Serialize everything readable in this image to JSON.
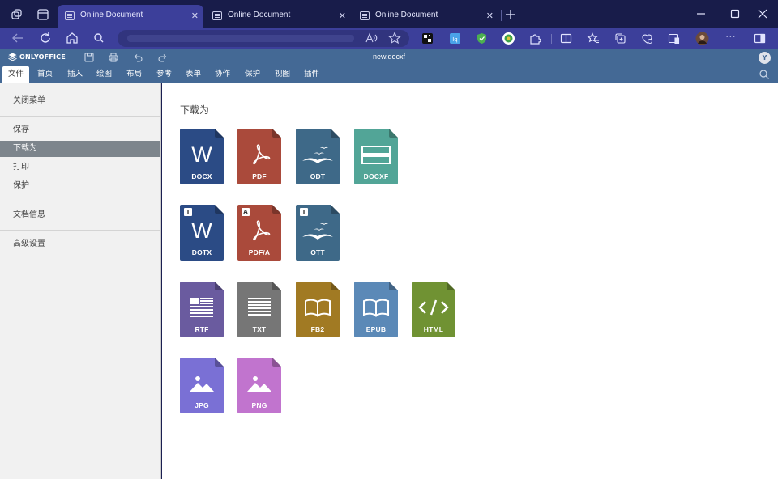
{
  "browser": {
    "tabs": [
      {
        "title": "Online Document",
        "active": true
      },
      {
        "title": "Online Document",
        "active": false
      },
      {
        "title": "Online Document",
        "active": false
      }
    ],
    "colors": {
      "titlebar": "#181c4a",
      "toolbar": "#3c3f9a"
    }
  },
  "app": {
    "logo_text": "ONLYOFFICE",
    "document_name": "new.docxf",
    "user_initial": "Y",
    "menu_tabs": [
      "文件",
      "首页",
      "插入",
      "绘图",
      "布局",
      "参考",
      "表单",
      "协作",
      "保护",
      "视图",
      "插件"
    ],
    "active_tab": "文件",
    "header_color": "#446995"
  },
  "sidebar": {
    "close_menu": "关闭菜单",
    "items": [
      "保存",
      "下载为",
      "打印",
      "保护"
    ],
    "active_item": "下载为",
    "doc_info": "文档信息",
    "advanced": "高级设置"
  },
  "download": {
    "title": "下载为",
    "formats": [
      {
        "label": "DOCX",
        "color": "#2b4b85",
        "icon": "word-icon",
        "badge": ""
      },
      {
        "label": "PDF",
        "color": "#aa4a3b",
        "icon": "pdf-icon",
        "badge": ""
      },
      {
        "label": "ODT",
        "color": "#3e6988",
        "icon": "odt-gulls-icon",
        "badge": ""
      },
      {
        "label": "DOCXF",
        "color": "#52a597",
        "icon": "form-fields-icon",
        "badge": ""
      },
      {
        "label": "DOTX",
        "color": "#2b4b85",
        "icon": "word-icon",
        "badge": "T"
      },
      {
        "label": "PDF/A",
        "color": "#aa4a3b",
        "icon": "pdf-icon",
        "badge": "A"
      },
      {
        "label": "OTT",
        "color": "#3e6988",
        "icon": "odt-gulls-icon",
        "badge": "T"
      },
      {
        "label": "RTF",
        "color": "#6a5b9f",
        "icon": "rich-text-icon",
        "badge": ""
      },
      {
        "label": "TXT",
        "color": "#767676",
        "icon": "plain-text-icon",
        "badge": ""
      },
      {
        "label": "FB2",
        "color": "#a17a23",
        "icon": "book-icon",
        "badge": ""
      },
      {
        "label": "EPUB",
        "color": "#5b89b7",
        "icon": "book-icon",
        "badge": ""
      },
      {
        "label": "HTML",
        "color": "#709233",
        "icon": "code-icon",
        "badge": ""
      },
      {
        "label": "JPG",
        "color": "#7a70d5",
        "icon": "image-icon",
        "badge": ""
      },
      {
        "label": "PNG",
        "color": "#c174ce",
        "icon": "image-icon",
        "badge": ""
      }
    ]
  }
}
